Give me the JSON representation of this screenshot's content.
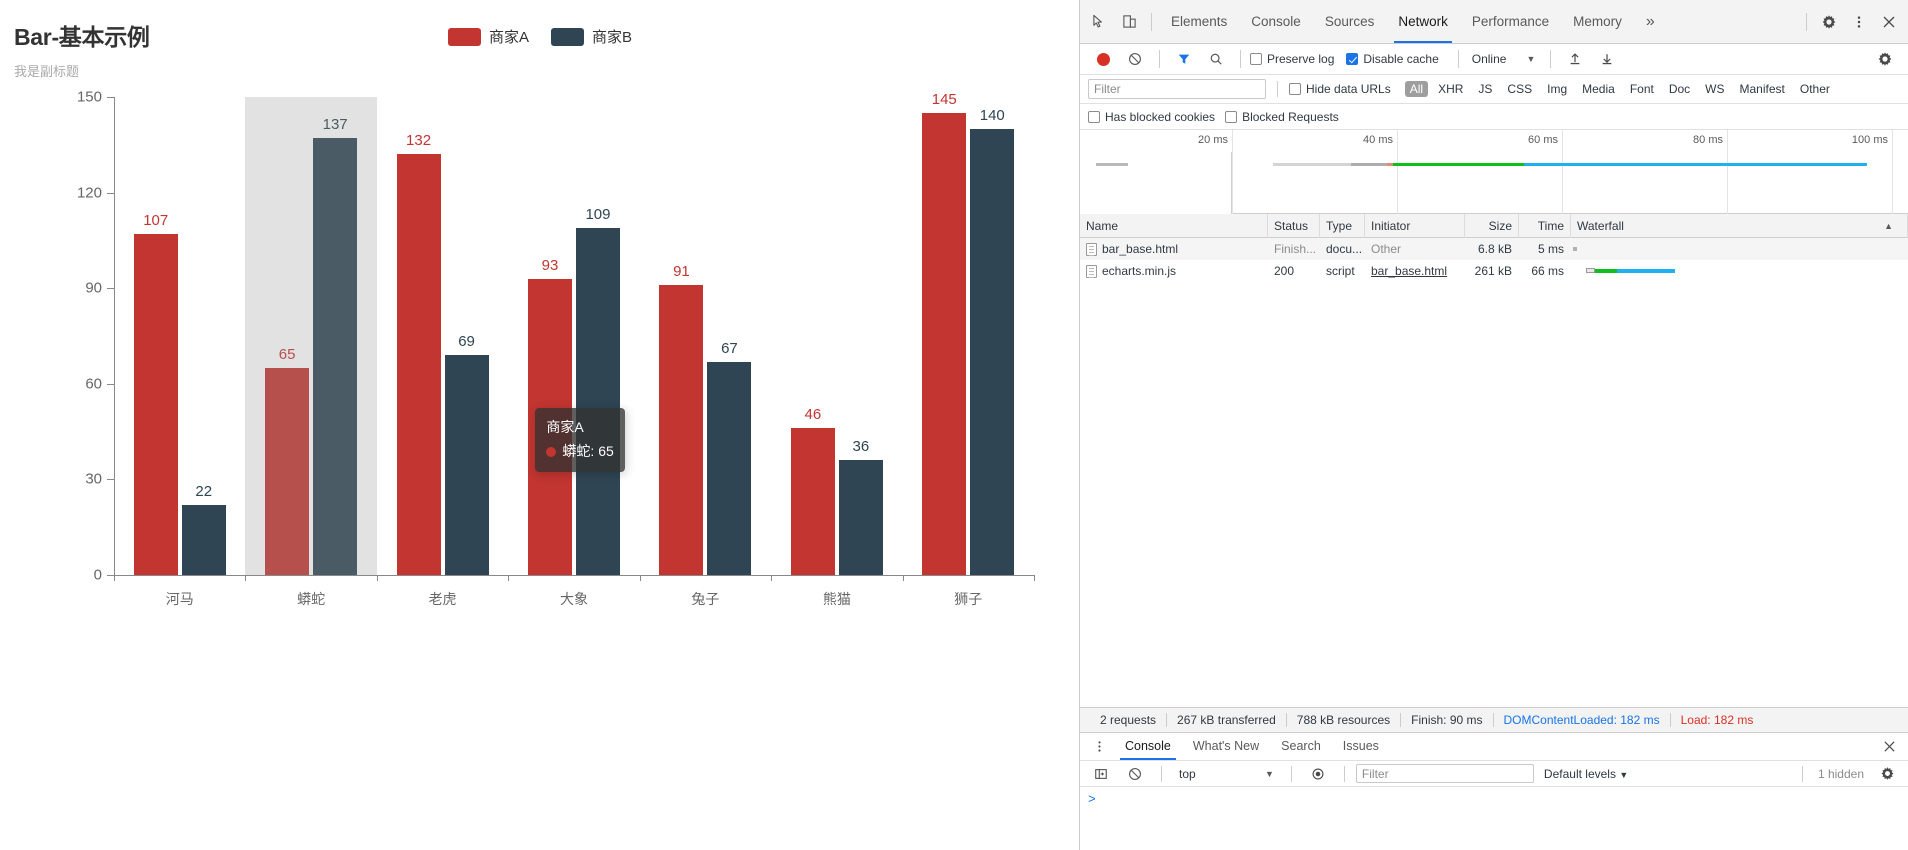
{
  "chart_data": {
    "type": "bar",
    "title": "Bar-基本示例",
    "subtitle": "我是副标题",
    "categories": [
      "河马",
      "蟒蛇",
      "老虎",
      "大象",
      "兔子",
      "熊猫",
      "狮子"
    ],
    "series": [
      {
        "name": "商家A",
        "color": "#c23531",
        "values": [
          107,
          65,
          132,
          93,
          91,
          46,
          145
        ]
      },
      {
        "name": "商家B",
        "color": "#2f4554",
        "values": [
          22,
          137,
          69,
          109,
          67,
          36,
          140
        ]
      }
    ],
    "xlabel": "",
    "ylabel": "",
    "ylim": [
      0,
      150
    ],
    "yticks": [
      0,
      30,
      60,
      90,
      120,
      150
    ],
    "grid": false,
    "legend_position": "top-center",
    "legend": [
      "商家A",
      "商家B"
    ],
    "data_labels": true
  },
  "tooltip": {
    "title": "商家A",
    "series_name": "蟒蛇",
    "value": "65",
    "marker_color": "#c23531",
    "row_text": "蟒蛇: 65"
  },
  "devtools": {
    "tabs": [
      {
        "label": "Elements",
        "active": false
      },
      {
        "label": "Console",
        "active": false
      },
      {
        "label": "Sources",
        "active": false
      },
      {
        "label": "Network",
        "active": true
      },
      {
        "label": "Performance",
        "active": false
      },
      {
        "label": "Memory",
        "active": false
      }
    ],
    "more_tabs_label": "»",
    "icons": {
      "inspect": "inspect-element-icon",
      "device": "device-toolbar-icon",
      "settings": "gear-icon",
      "menu": "kebab-menu-icon",
      "close": "close-icon"
    },
    "network_toolbar": {
      "record_label": "record-button",
      "clear_label": "clear-button",
      "filter_label": "filter-toggle",
      "search_label": "search-button",
      "preserve_log": {
        "label": "Preserve log",
        "checked": false
      },
      "disable_cache": {
        "label": "Disable cache",
        "checked": true
      },
      "throttle": "Online",
      "import_label": "import-har-button",
      "export_label": "export-har-button"
    },
    "filter_bar": {
      "filter_placeholder": "Filter",
      "filter_value": "",
      "hide_data_urls": {
        "label": "Hide data URLs",
        "checked": false
      },
      "types": [
        "All",
        "XHR",
        "JS",
        "CSS",
        "Img",
        "Media",
        "Font",
        "Doc",
        "WS",
        "Manifest",
        "Other"
      ],
      "active_type": "All",
      "has_blocked_cookies": {
        "label": "Has blocked cookies",
        "checked": false
      },
      "blocked_requests": {
        "label": "Blocked Requests",
        "checked": false
      }
    },
    "overview": {
      "ticks": [
        "20 ms",
        "40 ms",
        "60 ms",
        "80 ms",
        "100 ms"
      ]
    },
    "table": {
      "columns": [
        "Name",
        "Status",
        "Type",
        "Initiator",
        "Size",
        "Time",
        "Waterfall"
      ],
      "sort_indicator": "▲",
      "rows": [
        {
          "name": "bar_base.html",
          "status": "Finish...",
          "type": "docu...",
          "initiator": "Other",
          "size": "6.8 kB",
          "time": "5 ms"
        },
        {
          "name": "echarts.min.js",
          "status": "200",
          "type": "script",
          "initiator": "bar_base.html",
          "size": "261 kB",
          "time": "66 ms"
        }
      ]
    },
    "summary": {
      "requests": "2 requests",
      "transferred": "267 kB transferred",
      "resources": "788 kB resources",
      "finish": "Finish: 90 ms",
      "dom_content_loaded": "DOMContentLoaded: 182 ms",
      "load": "Load: 182 ms"
    },
    "drawer": {
      "tabs": [
        {
          "label": "Console",
          "active": true
        },
        {
          "label": "What's New",
          "active": false
        },
        {
          "label": "Search",
          "active": false
        },
        {
          "label": "Issues",
          "active": false
        }
      ],
      "context": "top",
      "filter_placeholder": "Filter",
      "filter_value": "",
      "levels": "Default levels",
      "hidden": "1 hidden",
      "prompt": ">"
    }
  }
}
